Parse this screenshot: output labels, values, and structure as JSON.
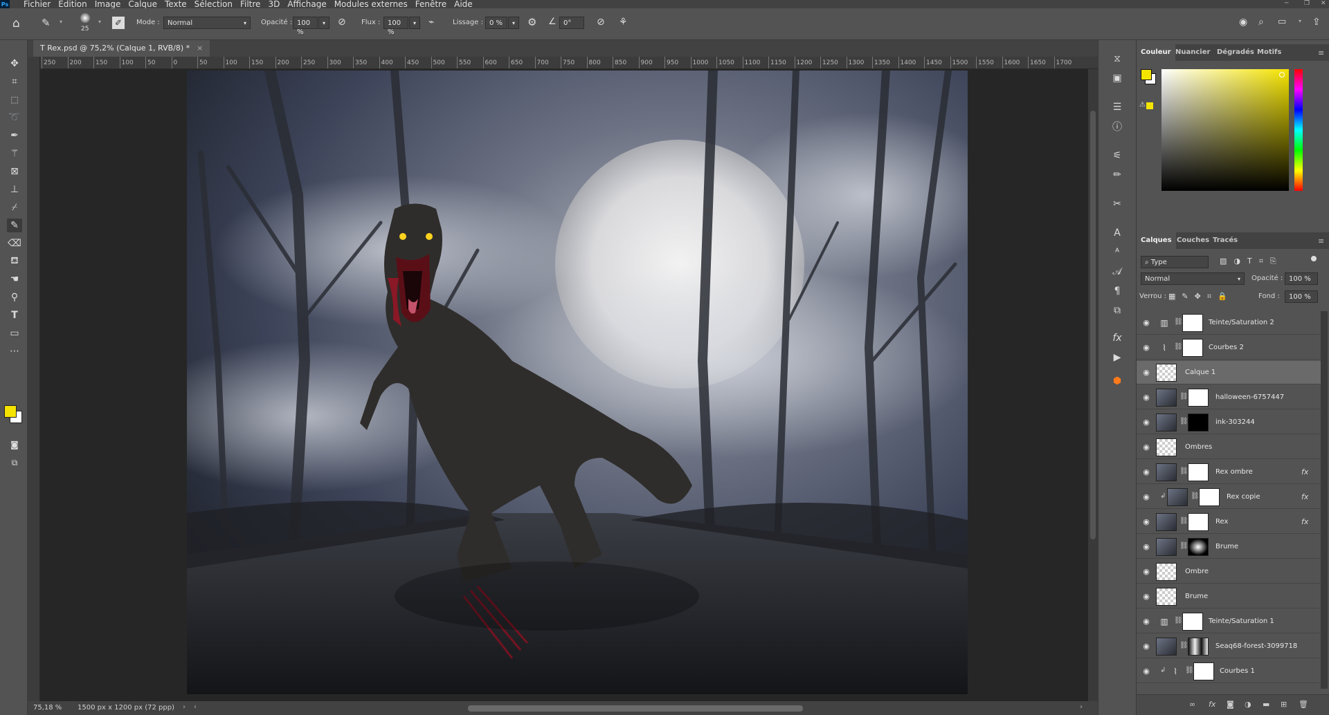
{
  "menubar": {
    "logo": "Ps",
    "items": [
      "Fichier",
      "Edition",
      "Image",
      "Calque",
      "Texte",
      "Sélection",
      "Filtre",
      "3D",
      "Affichage",
      "Modules externes",
      "Fenêtre",
      "Aide"
    ]
  },
  "options": {
    "brush_size": "25",
    "mode_label": "Mode :",
    "mode_value": "Normal",
    "opacity_label": "Opacité :",
    "opacity_value": "100 %",
    "flow_label": "Flux :",
    "flow_value": "100 %",
    "smoothing_label": "Lissage :",
    "smoothing_value": "0 %",
    "angle_value": "0°"
  },
  "document": {
    "tab_title": "T Rex.psd @ 75,2% (Calque 1, RVB/8) *",
    "zoom": "75,18 %",
    "doc_info": "1500 px x 1200 px (72 ppp)",
    "ruler_ticks": [
      "250",
      "200",
      "150",
      "100",
      "50",
      "0",
      "50",
      "100",
      "150",
      "200",
      "250",
      "300",
      "350",
      "400",
      "450",
      "500",
      "550",
      "600",
      "650",
      "700",
      "750",
      "800",
      "850",
      "900",
      "950",
      "1000",
      "1050",
      "1100",
      "1150",
      "1200",
      "1250",
      "1300",
      "1350",
      "1400",
      "1450",
      "1500",
      "1550",
      "1600",
      "1650",
      "1700"
    ]
  },
  "color_panel": {
    "tabs": [
      "Couleur",
      "Nuancier",
      "Dégradés",
      "Motifs"
    ],
    "foreground": "#f5e400",
    "background": "#ffffff"
  },
  "layers_panel": {
    "tabs": [
      "Calques",
      "Couches",
      "Tracés"
    ],
    "filter_kind": "Type",
    "blend_mode": "Normal",
    "opacity_label": "Opacité :",
    "opacity_value": "100 %",
    "lock_label": "Verrou :",
    "fill_label": "Fond :",
    "fill_value": "100 %",
    "layers": [
      {
        "name": "Teinte/Saturation 2",
        "kind": "adjustment-hue",
        "selected": false,
        "fx": ""
      },
      {
        "name": "Courbes 2",
        "kind": "adjustment-curves",
        "selected": false,
        "fx": ""
      },
      {
        "name": "Calque 1",
        "kind": "pixel",
        "selected": true,
        "fx": ""
      },
      {
        "name": "halloween-6757447",
        "kind": "smart-mask",
        "selected": false,
        "fx": ""
      },
      {
        "name": "ink-303244",
        "kind": "smart-mask-dark",
        "selected": false,
        "fx": ""
      },
      {
        "name": "Ombres",
        "kind": "pixel",
        "selected": false,
        "fx": ""
      },
      {
        "name": "Rex ombre",
        "kind": "smart-mask",
        "selected": false,
        "fx": "fx"
      },
      {
        "name": "Rex copie",
        "kind": "clipped-smart-mask",
        "selected": false,
        "fx": "fx"
      },
      {
        "name": "Rex",
        "kind": "smart-mask",
        "selected": false,
        "fx": "fx"
      },
      {
        "name": "Brume",
        "kind": "mask-radial",
        "selected": false,
        "fx": ""
      },
      {
        "name": "Ombre",
        "kind": "pixel",
        "selected": false,
        "fx": ""
      },
      {
        "name": "Brume",
        "kind": "pixel",
        "selected": false,
        "fx": ""
      },
      {
        "name": "Teinte/Saturation 1",
        "kind": "adjustment-hue",
        "selected": false,
        "fx": ""
      },
      {
        "name": "Seaq68-forest-3099718",
        "kind": "image-mask",
        "selected": false,
        "fx": ""
      },
      {
        "name": "Courbes 1",
        "kind": "clipped-adjustment-curves",
        "selected": false,
        "fx": ""
      }
    ]
  }
}
